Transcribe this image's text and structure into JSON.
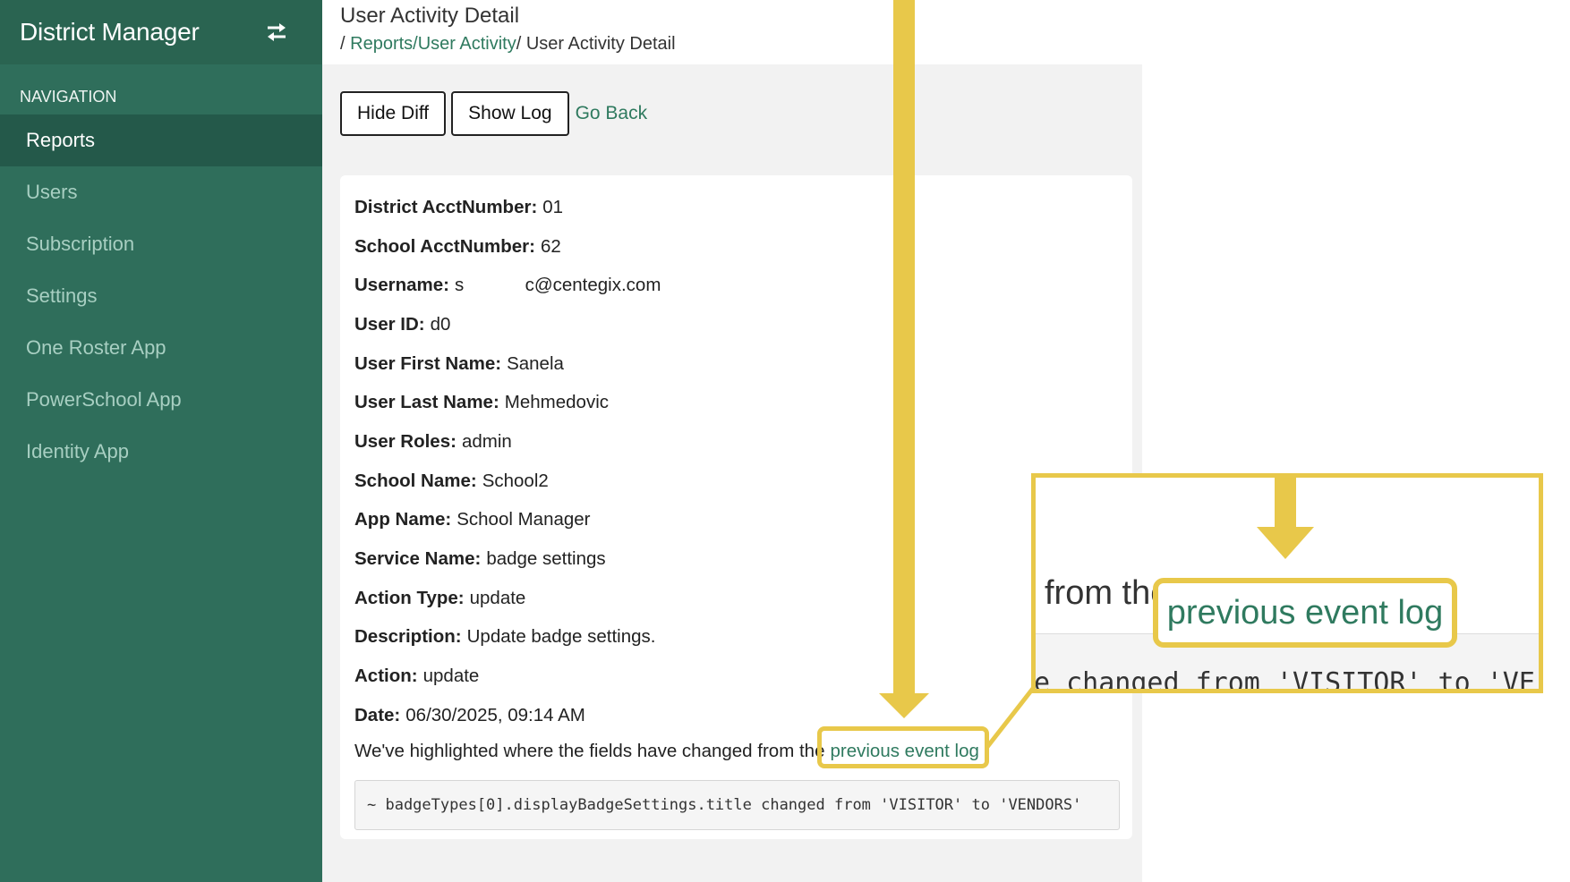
{
  "sidebar": {
    "brand": "District Manager",
    "toggle_icon": "swap-arrows-icon",
    "nav_heading": "NAVIGATION",
    "items": [
      {
        "label": "Reports",
        "active": true
      },
      {
        "label": "Users",
        "active": false
      },
      {
        "label": "Subscription",
        "active": false
      },
      {
        "label": "Settings",
        "active": false
      },
      {
        "label": "One Roster App",
        "active": false
      },
      {
        "label": "PowerSchool App",
        "active": false
      },
      {
        "label": "Identity App",
        "active": false
      }
    ]
  },
  "header": {
    "title": "User Activity Detail",
    "breadcrumb": {
      "sep": "/ ",
      "link": "Reports/User Activity",
      "current": "/ User Activity Detail"
    }
  },
  "toolbar": {
    "hide_diff_label": "Hide Diff",
    "show_log_label": "Show Log",
    "go_back_label": "Go Back"
  },
  "details": {
    "fields": [
      {
        "label": "District AcctNumber:",
        "value": "01"
      },
      {
        "label": "School AcctNumber:",
        "value": "62"
      },
      {
        "label": "Username:",
        "value": "s            c@centegix.com"
      },
      {
        "label": "User ID:",
        "value": "d0"
      },
      {
        "label": "User First Name:",
        "value": "Sanela"
      },
      {
        "label": "User Last Name:",
        "value": "Mehmedovic"
      },
      {
        "label": "User Roles:",
        "value": "admin"
      },
      {
        "label": "School Name:",
        "value": "School2"
      },
      {
        "label": "App Name:",
        "value": "School Manager"
      },
      {
        "label": "Service Name:",
        "value": "badge settings"
      },
      {
        "label": "Action Type:",
        "value": "update"
      },
      {
        "label": "Description:",
        "value": "Update badge settings."
      },
      {
        "label": "Action:",
        "value": "update"
      },
      {
        "label": "Date:",
        "value": "06/30/2025, 09:14 AM"
      }
    ],
    "note_text": "We've highlighted where the fields have changed from the",
    "note_link": "previous event log",
    "diff_line": "~ badgeTypes[0].displayBadgeSettings.title changed from 'VISITOR' to 'VENDORS'"
  },
  "annotation": {
    "color": "#e8c84a",
    "zoom_text": "from the",
    "zoom_link": "previous event log",
    "zoom_code": "e changed from 'VISITOR' to 'VE"
  }
}
